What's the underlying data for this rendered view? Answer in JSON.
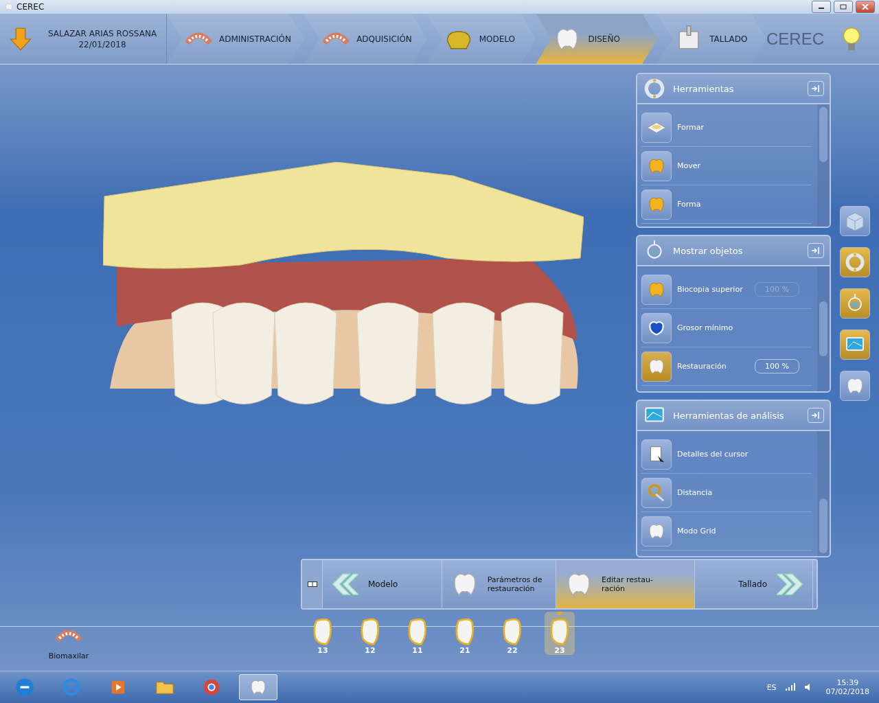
{
  "window": {
    "title": "CEREC"
  },
  "header": {
    "patient_name": "SALAZAR ARIAS ROSSANA",
    "patient_date": "22/01/2018",
    "logo": "CEREC",
    "steps": [
      {
        "label": "ADMINISTRACIÓN",
        "selected": false
      },
      {
        "label": "ADQUISICIÓN",
        "selected": false
      },
      {
        "label": "MODELO",
        "selected": false
      },
      {
        "label": "DISEÑO",
        "selected": true
      },
      {
        "label": "TALLADO",
        "selected": false
      }
    ]
  },
  "panels": [
    {
      "title": "Herramientas",
      "items": [
        {
          "label": "Formar",
          "active": false
        },
        {
          "label": "Mover",
          "active": false
        },
        {
          "label": "Forma",
          "active": false
        }
      ]
    },
    {
      "title": "Mostrar objetos",
      "items": [
        {
          "label": "Biocopia superior",
          "value": "100 %",
          "active": false,
          "kind": "slider"
        },
        {
          "label": "Grosor mínimo",
          "active": false,
          "kind": "plain"
        },
        {
          "label": "Restauración",
          "value": "100 %",
          "active": true,
          "kind": "value"
        }
      ]
    },
    {
      "title": "Herramientas de análisis",
      "items": [
        {
          "label": "Detalles del cursor",
          "active": false
        },
        {
          "label": "Distancia",
          "active": false
        },
        {
          "label": "Modo Grid",
          "active": false
        }
      ]
    }
  ],
  "side_buttons": [
    {
      "active": false
    },
    {
      "active": true
    },
    {
      "active": true
    },
    {
      "active": true
    },
    {
      "active": false
    }
  ],
  "workflow": {
    "back": "Modelo",
    "next": "Tallado",
    "steps": [
      {
        "label": "Parámetros de restauración",
        "selected": false
      },
      {
        "label": "Editar restau-ración",
        "selected": true
      }
    ]
  },
  "teeth": [
    {
      "number": "13",
      "selected": false
    },
    {
      "number": "12",
      "selected": false
    },
    {
      "number": "11",
      "selected": false
    },
    {
      "number": "21",
      "selected": false
    },
    {
      "number": "22",
      "selected": false
    },
    {
      "number": "23",
      "selected": true
    }
  ],
  "tray": {
    "label": "Biomaxilar"
  },
  "taskbar": {
    "language": "ES",
    "time": "15:39",
    "date": "07/02/2018"
  }
}
